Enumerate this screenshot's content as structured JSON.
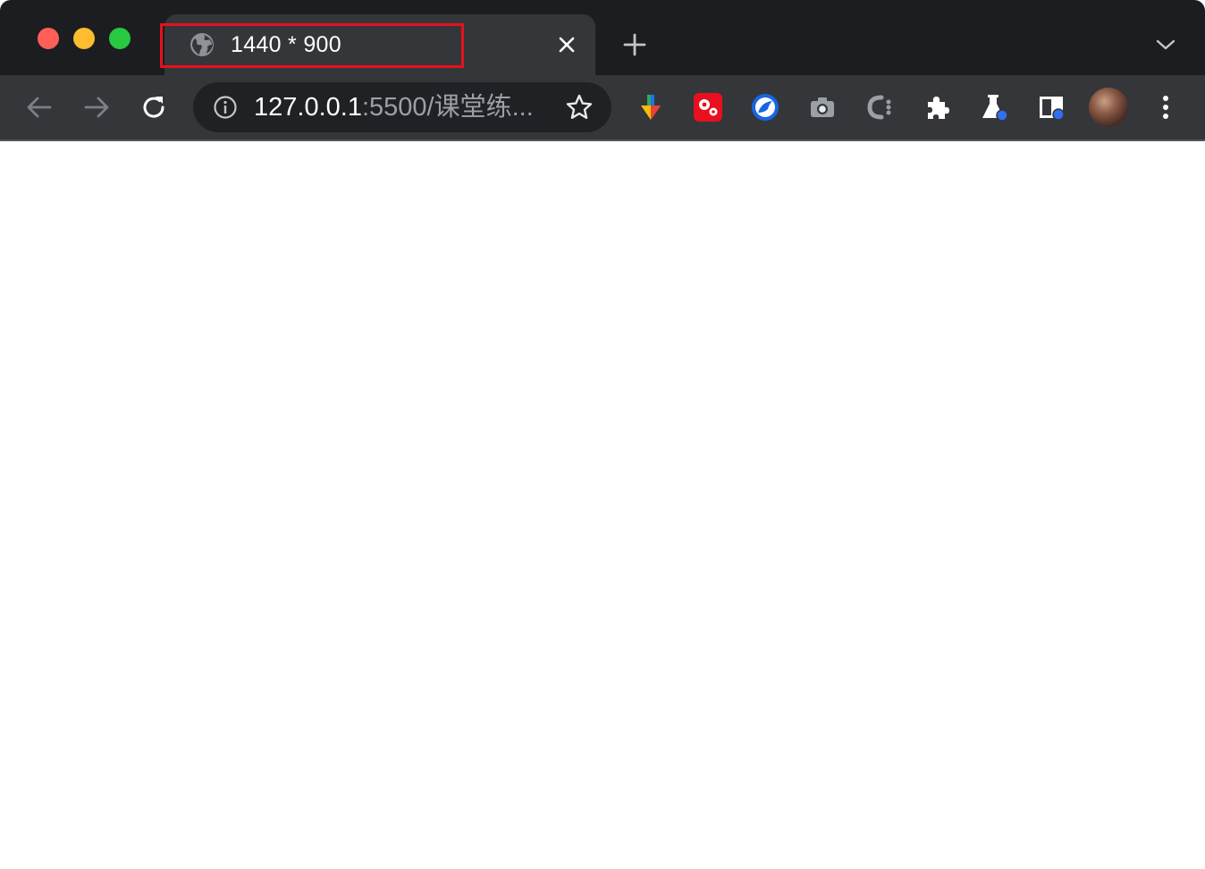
{
  "window": {
    "traffic_lights": {
      "close_color": "#fe5f57",
      "minimize_color": "#febc2e",
      "maximize_color": "#28c840"
    }
  },
  "tab": {
    "title": "1440 * 900",
    "favicon": "globe-icon",
    "highlight_color": "#e8101e"
  },
  "address_bar": {
    "host": "127.0.0.1",
    "rest": ":5500/课堂练...",
    "security_icon": "info-icon"
  },
  "extensions": [
    {
      "name": "colorful-arrow-extension-icon"
    },
    {
      "name": "red-gears-extension-icon"
    },
    {
      "name": "blue-bird-extension-icon"
    },
    {
      "name": "camera-extension-icon"
    },
    {
      "name": "c-dots-extension-icon"
    },
    {
      "name": "puzzle-extensions-icon"
    },
    {
      "name": "flask-labs-icon"
    },
    {
      "name": "side-panel-icon"
    }
  ],
  "colors": {
    "tabstrip_bg": "#1c1d20",
    "active_tab_bg": "#35363a",
    "omnibox_bg": "#202124",
    "page_bg": "#ffffff"
  }
}
